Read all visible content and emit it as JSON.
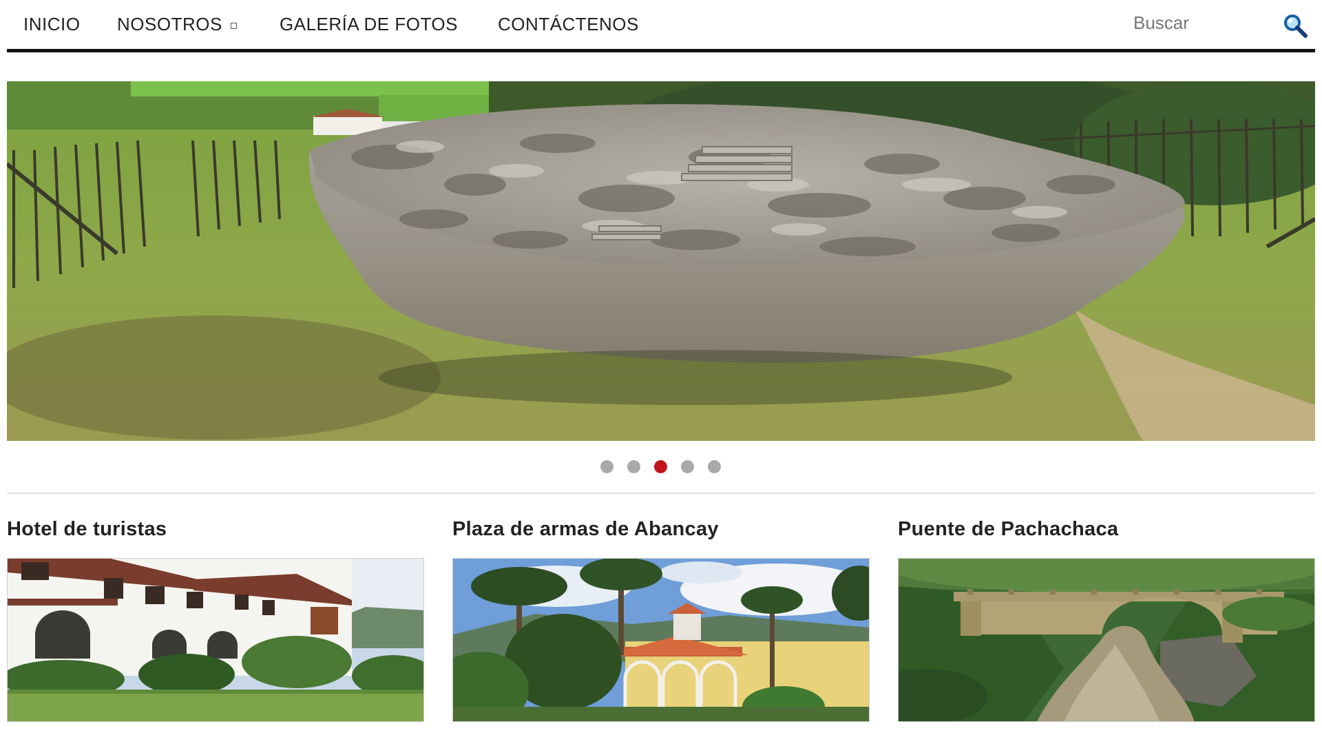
{
  "nav": {
    "items": [
      {
        "label": "INICIO"
      },
      {
        "label": "NOSOTROS",
        "has_dropdown": true
      },
      {
        "label": "GALERÍA DE FOTOS"
      },
      {
        "label": "CONTÁCTENOS"
      }
    ]
  },
  "search": {
    "placeholder": "Buscar",
    "icon": "magnifier-icon"
  },
  "slider": {
    "total_slides": 5,
    "active_index": 2
  },
  "cards": [
    {
      "title": "Hotel de turistas"
    },
    {
      "title": "Plaza de armas de Abancay"
    },
    {
      "title": "Puente de Pachachaca"
    }
  ],
  "colors": {
    "active_dot": "#c2151b",
    "inactive_dot": "#a9a9a9",
    "nav_border": "#111111",
    "text": "#222222"
  }
}
